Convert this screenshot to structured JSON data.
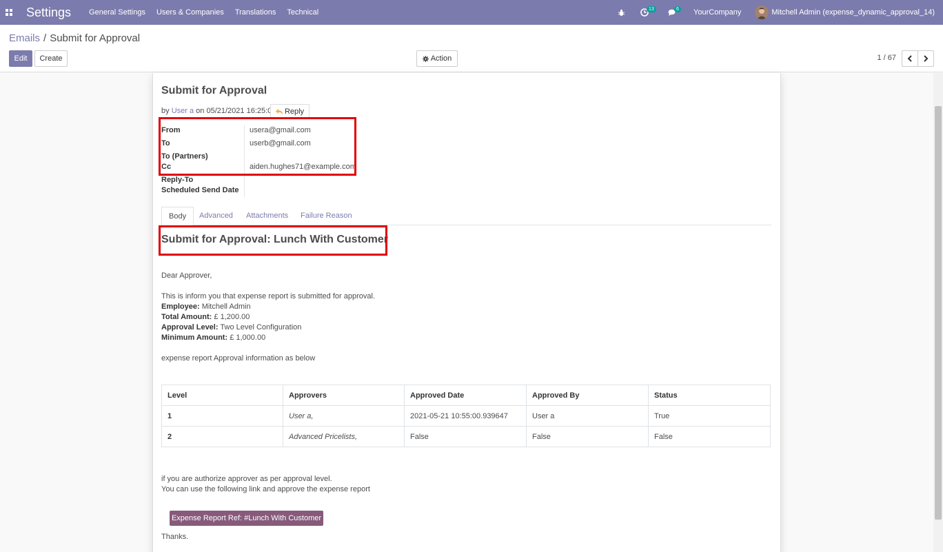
{
  "navbar": {
    "app_title": "Settings",
    "menu": [
      "General Settings",
      "Users & Companies",
      "Translations",
      "Technical"
    ],
    "activity_count": "13",
    "message_count": "6",
    "company": "YourCompany",
    "user": "Mitchell Admin (expense_dynamic_approval_14)",
    "color": "#7c7bad"
  },
  "breadcrumb": {
    "parent": "Emails",
    "separator": "/",
    "current": "Submit for Approval"
  },
  "toolbar": {
    "edit": "Edit",
    "create": "Create",
    "action": "Action",
    "pager": "1 / 67"
  },
  "message": {
    "subject": "Submit for Approval",
    "by_label": "by",
    "author": "User a",
    "on_label": "on",
    "datetime": "05/21/2021 16:25:00",
    "reply": "Reply"
  },
  "fields": {
    "from_label": "From",
    "from_value": "usera@gmail.com",
    "to_label": "To",
    "to_value": "userb@gmail.com",
    "to_partners_label": "To (Partners)",
    "cc_label": "Cc",
    "cc_value": "aiden.hughes71@example.com",
    "reply_to_label": "Reply-To",
    "scheduled_label": "Scheduled Send Date"
  },
  "tabs": [
    "Body",
    "Advanced",
    "Attachments",
    "Failure Reason"
  ],
  "body": {
    "title": "Submit for Approval: Lunch With Customer",
    "greeting": "Dear Approver,",
    "intro": "This is inform you that expense report is submitted for approval.",
    "employee_label": "Employee:",
    "employee_value": "Mitchell Admin",
    "total_label": "Total Amount:",
    "total_value": "£ 1,200.00",
    "level_label": "Approval Level:",
    "level_value": "Two Level Configuration",
    "min_label": "Minimum Amount:",
    "min_value": "£ 1,000.00",
    "info_line": "expense report Approval information as below",
    "table": {
      "headers": [
        "Level",
        "Approvers",
        "Approved Date",
        "Approved By",
        "Status"
      ],
      "rows": [
        [
          "1",
          "User a,",
          "2021-05-21 10:55:00.939647",
          "User a",
          "True"
        ],
        [
          "2",
          "Advanced Pricelists,",
          "False",
          "False",
          "False"
        ]
      ]
    },
    "footer1": "if you are authorize approver as per approval level.",
    "footer2": "You can use the following link and approve the expense report",
    "ref_button": "Expense Report Ref: #Lunch With Customer",
    "thanks": "Thanks."
  },
  "colors": {
    "highlight": "#e00000",
    "ref_button": "#875a7b",
    "badge": "#00a09d"
  }
}
